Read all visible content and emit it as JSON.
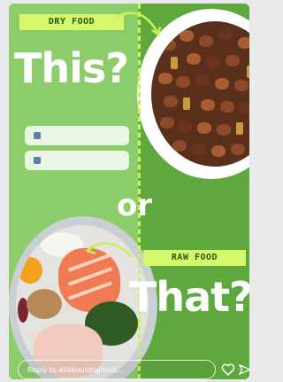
{
  "story": {
    "dry_tag": "DRY FOOD",
    "raw_tag": "RAW FOOD",
    "headline_top": "This?",
    "headline_mid": "or",
    "headline_bottom": "That?",
    "colors": {
      "left_panel": "#8ccc6a",
      "right_panel": "#5fa83e",
      "tag": "#d6f76a",
      "text": "#ffffff"
    }
  },
  "poll": {
    "options": [
      "",
      ""
    ]
  },
  "reply_bar": {
    "placeholder": "Reply to allaboutdogfood..."
  },
  "icons": {
    "like": "heart-icon",
    "share": "send-icon"
  }
}
